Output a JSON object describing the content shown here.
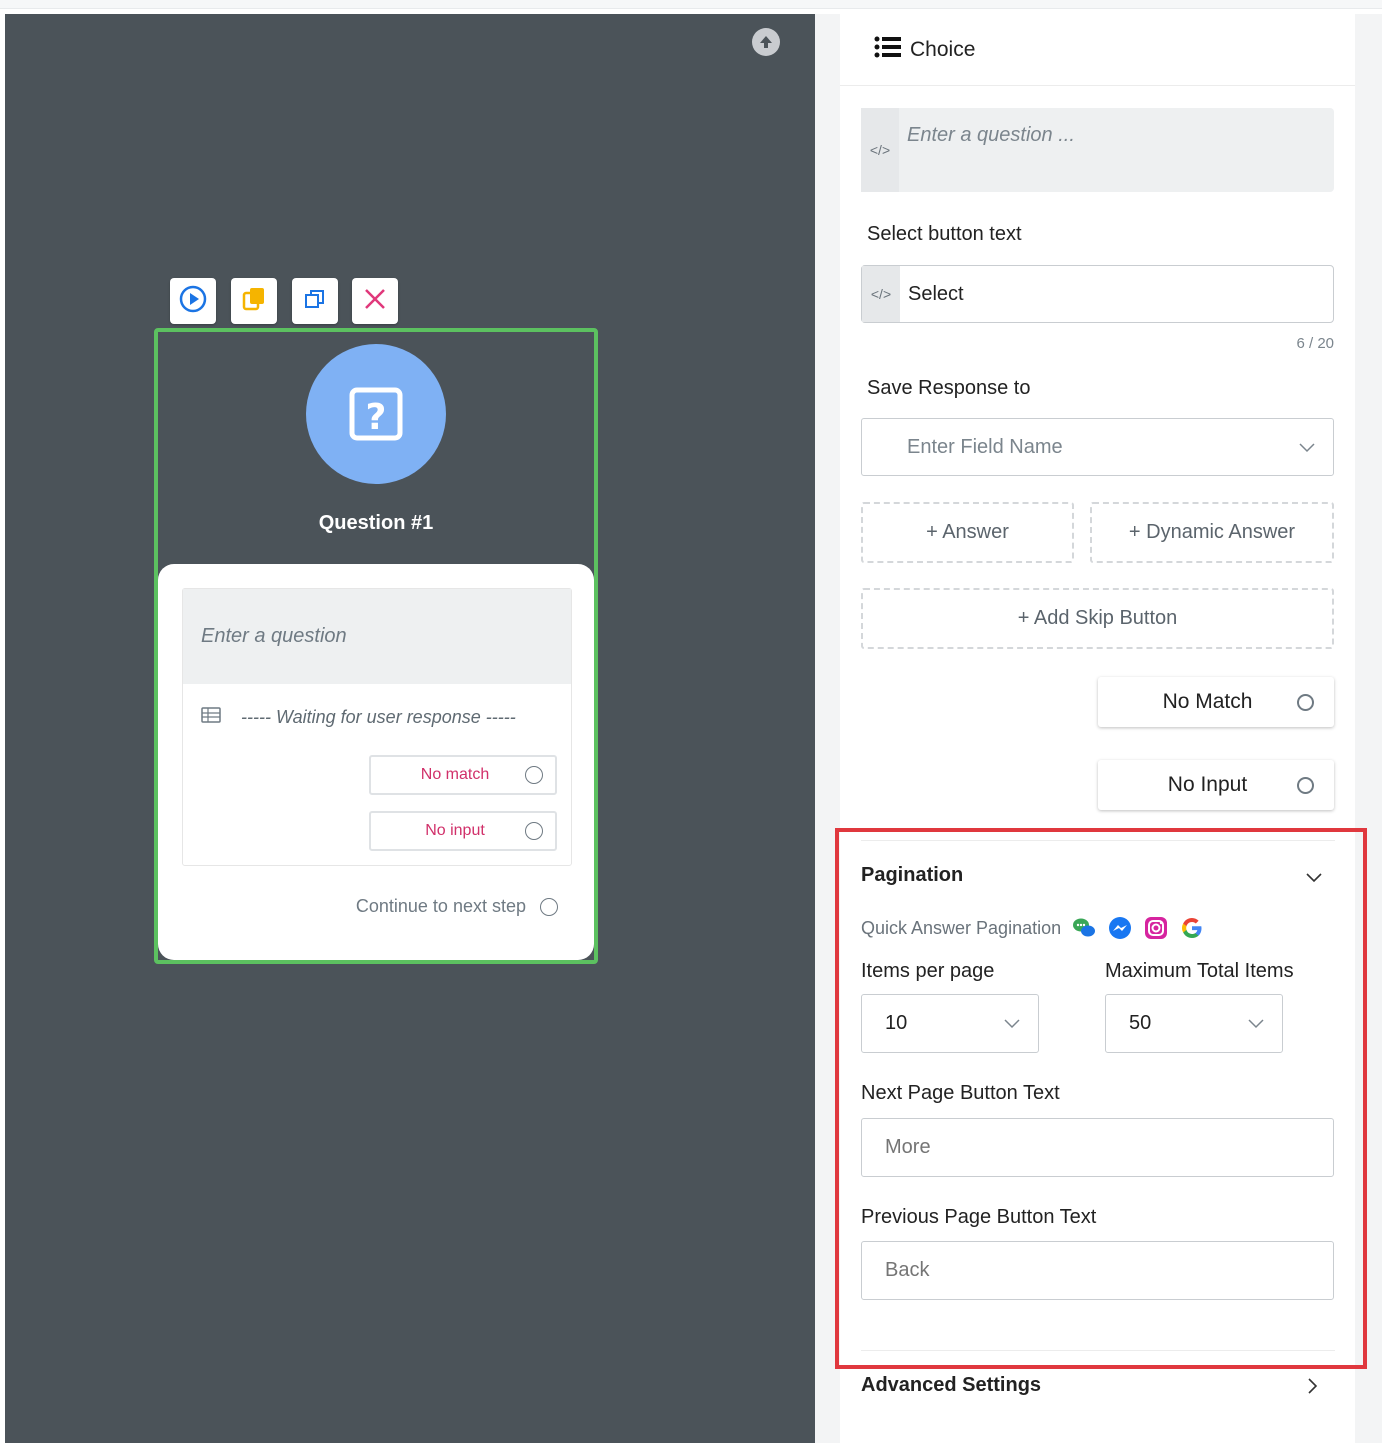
{
  "canvas": {
    "upload_icon": "upload-arrow-icon",
    "toolbar": [
      {
        "name": "play-icon",
        "color": "#1b74e4"
      },
      {
        "name": "copy-icon",
        "color": "#f5b400"
      },
      {
        "name": "duplicate-icon",
        "color": "#1b74e4"
      },
      {
        "name": "close-icon",
        "color": "#e0387b"
      }
    ],
    "node": {
      "icon": "question-mark-icon",
      "title": "Question #1",
      "question_placeholder": "Enter a question",
      "waiting_text": "----- Waiting for user response -----",
      "no_match": "No match",
      "no_input": "No input",
      "continue_text": "Continue to next step",
      "border_color": "#5cc160"
    }
  },
  "panel": {
    "header": {
      "icon": "list-icon",
      "title": "Choice"
    },
    "question": {
      "placeholder": "Enter a question ..."
    },
    "code_glyph": "</>",
    "select_button": {
      "label": "Select button text",
      "value": "Select",
      "counter": "6 / 20"
    },
    "save_response": {
      "label": "Save Response to",
      "placeholder": "Enter Field Name"
    },
    "add_answer": "+ Answer",
    "add_dynamic_answer": "+ Dynamic Answer",
    "add_skip": "+ Add Skip Button",
    "no_match": "No Match",
    "no_input": "No Input",
    "pagination": {
      "title": "Pagination",
      "quick_label": "Quick Answer Pagination",
      "channels": [
        "chat-bubbles-icon",
        "messenger-icon",
        "instagram-icon",
        "google-icon"
      ],
      "items_per_page_label": "Items per page",
      "items_per_page_value": "10",
      "max_items_label": "Maximum Total Items",
      "max_items_value": "50",
      "next_label": "Next Page Button Text",
      "next_placeholder": "More",
      "prev_label": "Previous Page Button Text",
      "prev_placeholder": "Back",
      "highlight_color": "#e0383e"
    },
    "advanced": "Advanced Settings"
  }
}
